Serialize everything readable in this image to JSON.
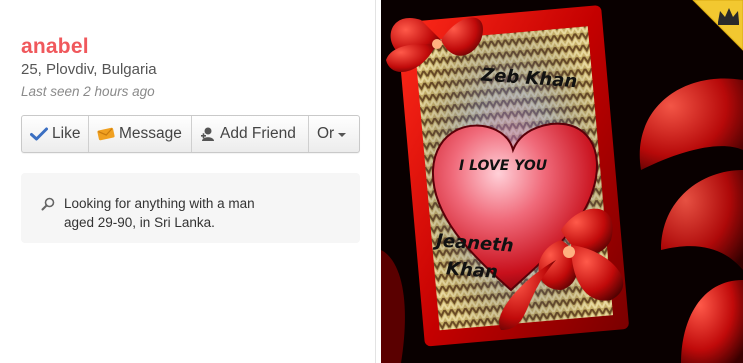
{
  "profile": {
    "name": "anabel",
    "meta": "25, Plovdiv, Bulgaria",
    "last_seen": "Last seen 2 hours ago"
  },
  "actions": {
    "like": "Like",
    "message": "Message",
    "add_friend": "Add Friend",
    "more": "Or"
  },
  "looking_for": {
    "line1": "Looking for anything with a man",
    "line2": "aged 29-90, in Sri Lanka."
  },
  "photo": {
    "text_top": "Zeb Khan",
    "text_center": "I LOVE YOU",
    "text_bottom_1": "Jeaneth",
    "text_bottom_2": "Khan"
  },
  "colors": {
    "name": "#f0585c",
    "crown_badge": "#f1c40f",
    "like_icon": "#3b6fc2",
    "message_icon": "#f0a020"
  }
}
